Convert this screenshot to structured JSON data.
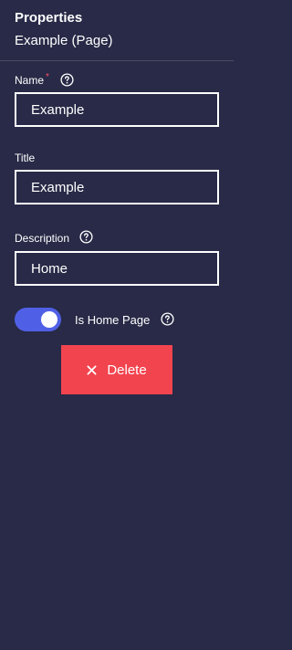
{
  "header": {
    "title": "Properties",
    "subtitle": "Example (Page)"
  },
  "fields": {
    "name": {
      "label": "Name",
      "required_mark": "*",
      "value": "Example"
    },
    "title": {
      "label": "Title",
      "value": "Example"
    },
    "description": {
      "label": "Description",
      "value": "Home"
    }
  },
  "home_page_toggle": {
    "label": "Is Home Page",
    "enabled": true
  },
  "actions": {
    "delete_label": "Delete"
  },
  "colors": {
    "background": "#282a47",
    "toggle_on": "#5060e6",
    "delete": "#f2444f",
    "required": "#ff4d6a"
  }
}
